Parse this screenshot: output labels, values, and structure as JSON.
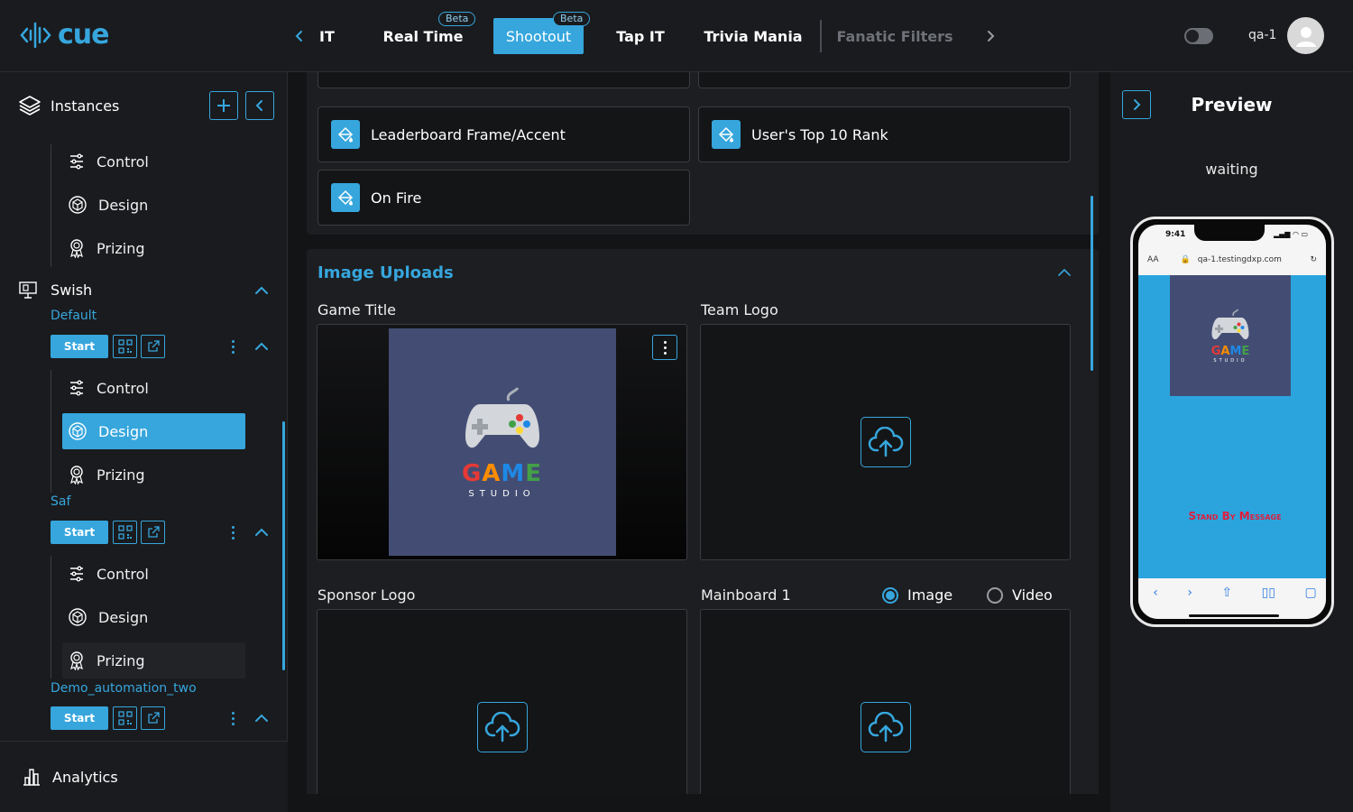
{
  "app": {
    "logo_text": "cue"
  },
  "header": {
    "tabs": [
      {
        "label": "Swish IT",
        "visible": "IT"
      },
      {
        "label": "Real Time",
        "badge": "Beta"
      },
      {
        "label": "Shootout",
        "badge": "Beta",
        "active": true
      },
      {
        "label": "Tap IT"
      },
      {
        "label": "Trivia Mania"
      },
      {
        "label": "Fanatic Filters",
        "disabled": true
      }
    ],
    "user": "qa-1"
  },
  "sidebar": {
    "title": "Instances",
    "groups": [
      {
        "name": "Swish"
      }
    ],
    "items_top": [
      "Control",
      "Design",
      "Prizing"
    ],
    "instances": [
      {
        "name": "Default",
        "start": "Start",
        "items": [
          "Control",
          "Design",
          "Prizing"
        ],
        "active_item": "Design"
      },
      {
        "name": "Saf",
        "start": "Start",
        "items": [
          "Control",
          "Design",
          "Prizing"
        ]
      },
      {
        "name": "Demo_automation_two",
        "start": "Start"
      }
    ],
    "footer": "Analytics"
  },
  "main": {
    "color_cards": [
      "Leaderboard Frame/Accent",
      "User's Top 10 Rank",
      "On Fire"
    ],
    "section_title": "Image Uploads",
    "fields": {
      "game_title": "Game Title",
      "team_logo": "Team Logo",
      "sponsor_logo": "Sponsor Logo",
      "mainboard": "Mainboard 1",
      "media_options": [
        "Image",
        "Video"
      ],
      "media_selected": "Image"
    },
    "game_logo": {
      "word": "GAME",
      "sub": "STUDIO"
    }
  },
  "preview": {
    "title": "Preview",
    "status": "waiting",
    "phone": {
      "time": "9:41",
      "text_size": "AA",
      "url": "qa-1.testingdxp.com",
      "message": "Stand By Message",
      "logo_word": "GAME",
      "logo_sub": "STUDIO"
    }
  },
  "colors": {
    "accent": "#36a6dd",
    "background": "#131416",
    "panel": "#1a1b1e",
    "game_tile": "#434d74"
  }
}
